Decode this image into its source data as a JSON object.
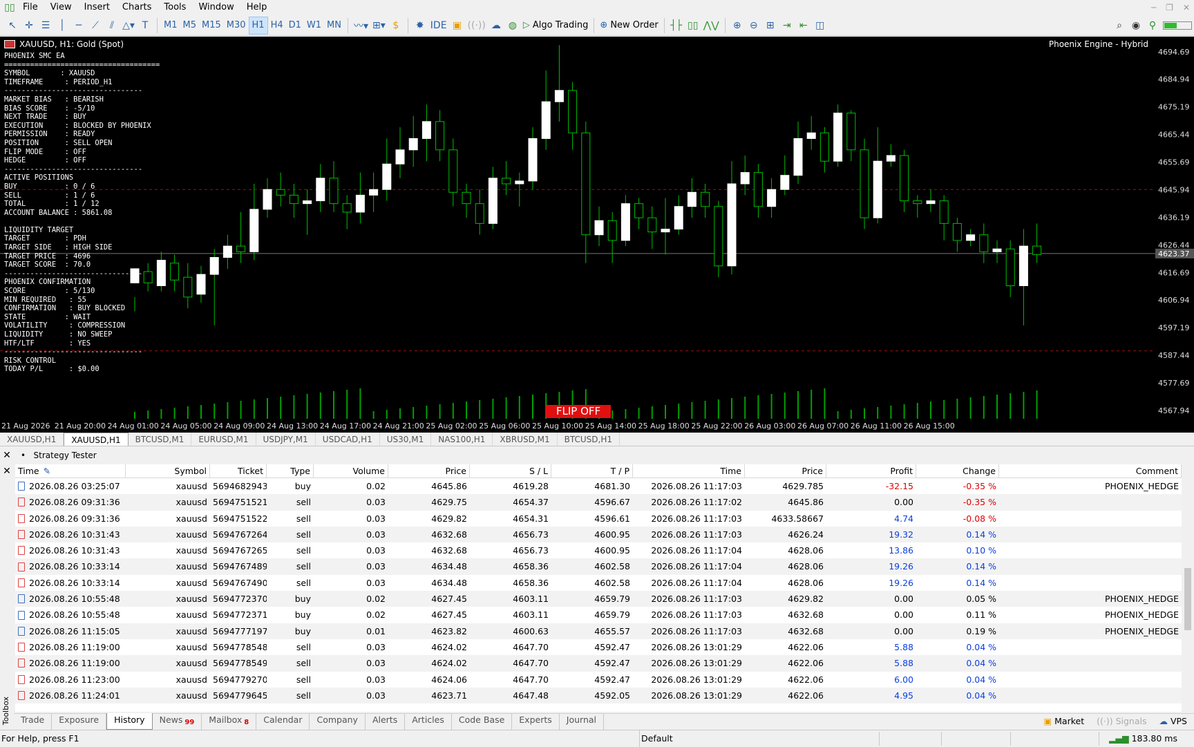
{
  "menu": [
    "File",
    "View",
    "Insert",
    "Charts",
    "Tools",
    "Window",
    "Help"
  ],
  "toolbar": {
    "timeframes": [
      "M1",
      "M5",
      "M15",
      "M30",
      "H1",
      "H4",
      "D1",
      "W1",
      "MN"
    ],
    "active_timeframe": "H1",
    "ide_label": "IDE",
    "algo_label": "Algo Trading",
    "new_order_label": "New Order"
  },
  "chart": {
    "title": "XAUUSD, H1:  Gold (Spot)",
    "engine": "Phoenix Engine - Hybrid",
    "flip_label": "FLIP OFF",
    "current_price": "4623.37",
    "price_labels": [
      "4694.69",
      "4684.94",
      "4675.19",
      "4665.44",
      "4655.69",
      "4645.94",
      "4636.19",
      "4626.44",
      "4616.69",
      "4606.94",
      "4597.19",
      "4587.44",
      "4577.69",
      "4567.94"
    ],
    "time_labels": [
      "21 Aug 2026",
      "21 Aug 20:00",
      "24 Aug 01:00",
      "24 Aug 05:00",
      "24 Aug 09:00",
      "24 Aug 13:00",
      "24 Aug 17:00",
      "24 Aug 21:00",
      "25 Aug 02:00",
      "25 Aug 06:00",
      "25 Aug 10:00",
      "25 Aug 14:00",
      "25 Aug 18:00",
      "25 Aug 22:00",
      "26 Aug 03:00",
      "26 Aug 07:00",
      "26 Aug 11:00",
      "26 Aug 15:00"
    ],
    "overlay_lines": [
      "PHOENIX SMC EA",
      "====================================",
      "SYMBOL       : XAUUSD",
      "TIMEFRAME     : PERIOD_H1",
      "--------------------------------",
      "MARKET BIAS   : BEARISH",
      "BIAS SCORE    : -5/10",
      "NEXT TRADE    : BUY",
      "EXECUTION     : BLOCKED BY PHOENIX",
      "PERMISSION    : READY",
      "POSITION      : SELL OPEN",
      "FLIP MODE     : OFF",
      "HEDGE         : OFF",
      "--------------------------------",
      "ACTIVE POSITIONS",
      "BUY           : 0 / 6",
      "SELL          : 1 / 6",
      "TOTAL         : 1 / 12",
      "ACCOUNT BALANCE : 5861.08",
      "",
      "LIQUIDITY TARGET",
      "TARGET        : PDH",
      "TARGET SIDE   : HIGH SIDE",
      "TARGET PRICE  : 4696",
      "TARGET SCORE  : 70.0",
      "--------------------------------",
      "PHOENIX CONFIRMATION",
      "SCORE         : 5/130",
      "MIN REQUIRED   : 55",
      "CONFIRMATION   : BUY BLOCKED",
      "STATE         : WAIT",
      "VOLATILITY     : COMPRESSION",
      "LIQUIDITY      : NO SWEEP",
      "HTF/LTF        : YES",
      "--------------------------------",
      "RISK CONTROL",
      "TODAY P/L      : $0.00"
    ]
  },
  "chart_data": {
    "type": "candlestick",
    "ylim": [
      4565,
      4700
    ],
    "candles": [
      [
        4613,
        4618,
        4608,
        4603
      ],
      [
        4617,
        4613,
        4620,
        4610
      ],
      [
        4612,
        4621,
        4610,
        4624
      ],
      [
        4620,
        4614,
        4610,
        4623
      ],
      [
        4615,
        4608,
        4604,
        4620
      ],
      [
        4609,
        4616,
        4606,
        4619
      ],
      [
        4616,
        4622,
        4598,
        4625
      ],
      [
        4622,
        4626,
        4618,
        4630
      ],
      [
        4626,
        4624,
        4620,
        4638
      ],
      [
        4624,
        4639,
        4621,
        4648
      ],
      [
        4639,
        4646,
        4636,
        4650
      ],
      [
        4646,
        4644,
        4640,
        4652
      ],
      [
        4644,
        4641,
        4636,
        4648
      ],
      [
        4641,
        4642,
        4630,
        4646
      ],
      [
        4642,
        4650,
        4638,
        4655
      ],
      [
        4650,
        4641,
        4638,
        4656
      ],
      [
        4641,
        4638,
        4632,
        4644
      ],
      [
        4638,
        4644,
        4634,
        4652
      ],
      [
        4644,
        4646,
        4638,
        4652
      ],
      [
        4646,
        4655,
        4642,
        4664
      ],
      [
        4655,
        4660,
        4650,
        4668
      ],
      [
        4660,
        4664,
        4654,
        4672
      ],
      [
        4664,
        4670,
        4656,
        4676
      ],
      [
        4670,
        4660,
        4656,
        4674
      ],
      [
        4660,
        4645,
        4640,
        4664
      ],
      [
        4645,
        4641,
        4636,
        4648
      ],
      [
        4641,
        4634,
        4630,
        4646
      ],
      [
        4634,
        4650,
        4632,
        4654
      ],
      [
        4650,
        4648,
        4644,
        4656
      ],
      [
        4648,
        4649,
        4640,
        4652
      ],
      [
        4649,
        4664,
        4646,
        4668
      ],
      [
        4664,
        4677,
        4660,
        4688
      ],
      [
        4677,
        4681,
        4670,
        4697
      ],
      [
        4681,
        4666,
        4660,
        4684
      ],
      [
        4666,
        4630,
        4620,
        4670
      ],
      [
        4630,
        4635,
        4626,
        4640
      ],
      [
        4635,
        4628,
        4620,
        4638
      ],
      [
        4628,
        4641,
        4626,
        4644
      ],
      [
        4641,
        4636,
        4632,
        4643
      ],
      [
        4636,
        4631,
        4625,
        4640
      ],
      [
        4631,
        4632,
        4623,
        4643
      ],
      [
        4632,
        4640,
        4630,
        4644
      ],
      [
        4640,
        4645,
        4636,
        4650
      ],
      [
        4645,
        4640,
        4636,
        4648
      ],
      [
        4640,
        4619,
        4615,
        4642
      ],
      [
        4619,
        4648,
        4616,
        4656
      ],
      [
        4648,
        4652,
        4644,
        4658
      ],
      [
        4652,
        4640,
        4636,
        4655
      ],
      [
        4640,
        4646,
        4636,
        4650
      ],
      [
        4646,
        4651,
        4644,
        4658
      ],
      [
        4651,
        4664,
        4648,
        4670
      ],
      [
        4664,
        4666,
        4660,
        4672
      ],
      [
        4666,
        4656,
        4652,
        4668
      ],
      [
        4656,
        4673,
        4654,
        4676
      ],
      [
        4673,
        4660,
        4656,
        4674
      ],
      [
        4660,
        4636,
        4632,
        4664
      ],
      [
        4636,
        4656,
        4634,
        4668
      ],
      [
        4656,
        4658,
        4654,
        4662
      ],
      [
        4658,
        4642,
        4638,
        4660
      ],
      [
        4642,
        4641,
        4636,
        4644
      ],
      [
        4641,
        4642,
        4638,
        4646
      ],
      [
        4642,
        4634,
        4628,
        4644
      ],
      [
        4634,
        4628,
        4624,
        4636
      ],
      [
        4628,
        4630,
        4626,
        4632
      ],
      [
        4630,
        4624,
        4620,
        4634
      ],
      [
        4624,
        4625,
        4620,
        4628
      ],
      [
        4625,
        4612,
        4608,
        4628
      ],
      [
        4612,
        4626,
        4598,
        4632
      ],
      [
        4626,
        4623,
        4620,
        4634
      ]
    ]
  },
  "symbol_tabs": [
    "XAUUSD,H1",
    "XAUUSD,H1",
    "BTCUSD,M1",
    "EURUSD,M1",
    "USDJPY,M1",
    "USDCAD,H1",
    "US30,M1",
    "NAS100,H1",
    "XBRUSD,M1",
    "BTCUSD,H1"
  ],
  "active_symbol_tab": 1,
  "tester_label": "Strategy Tester",
  "toolbox_label": "Toolbox",
  "table": {
    "headers": [
      "Time",
      "Symbol",
      "Ticket",
      "Type",
      "Volume",
      "Price",
      "S / L",
      "T / P",
      "Time",
      "Price",
      "Profit",
      "Change",
      "Comment"
    ],
    "rows": [
      [
        "2026.08.26 03:25:07",
        "xauusd",
        "5694682943",
        "buy",
        "0.02",
        "4645.86",
        "4619.28",
        "4681.30",
        "2026.08.26 11:17:03",
        "4629.785",
        "-32.15",
        "-0.35 %",
        "PHOENIX_HEDGE"
      ],
      [
        "2026.08.26 09:31:36",
        "xauusd",
        "5694751521",
        "sell",
        "0.03",
        "4629.75",
        "4654.37",
        "4596.67",
        "2026.08.26 11:17:02",
        "4645.86",
        "0.00",
        "-0.35 %",
        ""
      ],
      [
        "2026.08.26 09:31:36",
        "xauusd",
        "5694751522",
        "sell",
        "0.03",
        "4629.82",
        "4654.31",
        "4596.61",
        "2026.08.26 11:17:03",
        "4633.58667",
        "4.74",
        "-0.08 %",
        ""
      ],
      [
        "2026.08.26 10:31:43",
        "xauusd",
        "5694767264",
        "sell",
        "0.03",
        "4632.68",
        "4656.73",
        "4600.95",
        "2026.08.26 11:17:03",
        "4626.24",
        "19.32",
        "0.14 %",
        ""
      ],
      [
        "2026.08.26 10:31:43",
        "xauusd",
        "5694767265",
        "sell",
        "0.03",
        "4632.68",
        "4656.73",
        "4600.95",
        "2026.08.26 11:17:04",
        "4628.06",
        "13.86",
        "0.10 %",
        ""
      ],
      [
        "2026.08.26 10:33:14",
        "xauusd",
        "5694767489",
        "sell",
        "0.03",
        "4634.48",
        "4658.36",
        "4602.58",
        "2026.08.26 11:17:04",
        "4628.06",
        "19.26",
        "0.14 %",
        ""
      ],
      [
        "2026.08.26 10:33:14",
        "xauusd",
        "5694767490",
        "sell",
        "0.03",
        "4634.48",
        "4658.36",
        "4602.58",
        "2026.08.26 11:17:04",
        "4628.06",
        "19.26",
        "0.14 %",
        ""
      ],
      [
        "2026.08.26 10:55:48",
        "xauusd",
        "5694772370",
        "buy",
        "0.02",
        "4627.45",
        "4603.11",
        "4659.79",
        "2026.08.26 11:17:03",
        "4629.82",
        "0.00",
        "0.05 %",
        "PHOENIX_HEDGE"
      ],
      [
        "2026.08.26 10:55:48",
        "xauusd",
        "5694772371",
        "buy",
        "0.02",
        "4627.45",
        "4603.11",
        "4659.79",
        "2026.08.26 11:17:03",
        "4632.68",
        "0.00",
        "0.11 %",
        "PHOENIX_HEDGE"
      ],
      [
        "2026.08.26 11:15:05",
        "xauusd",
        "5694777197",
        "buy",
        "0.01",
        "4623.82",
        "4600.63",
        "4655.57",
        "2026.08.26 11:17:03",
        "4632.68",
        "0.00",
        "0.19 %",
        "PHOENIX_HEDGE"
      ],
      [
        "2026.08.26 11:19:00",
        "xauusd",
        "5694778548",
        "sell",
        "0.03",
        "4624.02",
        "4647.70",
        "4592.47",
        "2026.08.26 13:01:29",
        "4622.06",
        "5.88",
        "0.04 %",
        ""
      ],
      [
        "2026.08.26 11:19:00",
        "xauusd",
        "5694778549",
        "sell",
        "0.03",
        "4624.02",
        "4647.70",
        "4592.47",
        "2026.08.26 13:01:29",
        "4622.06",
        "5.88",
        "0.04 %",
        ""
      ],
      [
        "2026.08.26 11:23:00",
        "xauusd",
        "5694779270",
        "sell",
        "0.03",
        "4624.06",
        "4647.70",
        "4592.47",
        "2026.08.26 13:01:29",
        "4622.06",
        "6.00",
        "0.04 %",
        ""
      ],
      [
        "2026.08.26 11:24:01",
        "xauusd",
        "5694779645",
        "sell",
        "0.03",
        "4623.71",
        "4647.48",
        "4592.05",
        "2026.08.26 13:01:29",
        "4622.06",
        "4.95",
        "0.04 %",
        ""
      ]
    ]
  },
  "bottom_tabs": [
    {
      "label": "Trade",
      "badge": ""
    },
    {
      "label": "Exposure",
      "badge": ""
    },
    {
      "label": "History",
      "badge": ""
    },
    {
      "label": "News",
      "badge": "99"
    },
    {
      "label": "Mailbox",
      "badge": "8"
    },
    {
      "label": "Calendar",
      "badge": ""
    },
    {
      "label": "Company",
      "badge": ""
    },
    {
      "label": "Alerts",
      "badge": ""
    },
    {
      "label": "Articles",
      "badge": ""
    },
    {
      "label": "Code Base",
      "badge": ""
    },
    {
      "label": "Experts",
      "badge": ""
    },
    {
      "label": "Journal",
      "badge": ""
    }
  ],
  "active_bottom_tab": 2,
  "market": {
    "market": "Market",
    "signals": "Signals",
    "vps": "VPS"
  },
  "status": {
    "help": "For Help, press F1",
    "profile": "Default",
    "ping": "183.80 ms"
  },
  "colors": {
    "bull": "#ffffff",
    "bear": "#00c000",
    "neg": "#e00000",
    "pos": "#0a3fe0"
  }
}
